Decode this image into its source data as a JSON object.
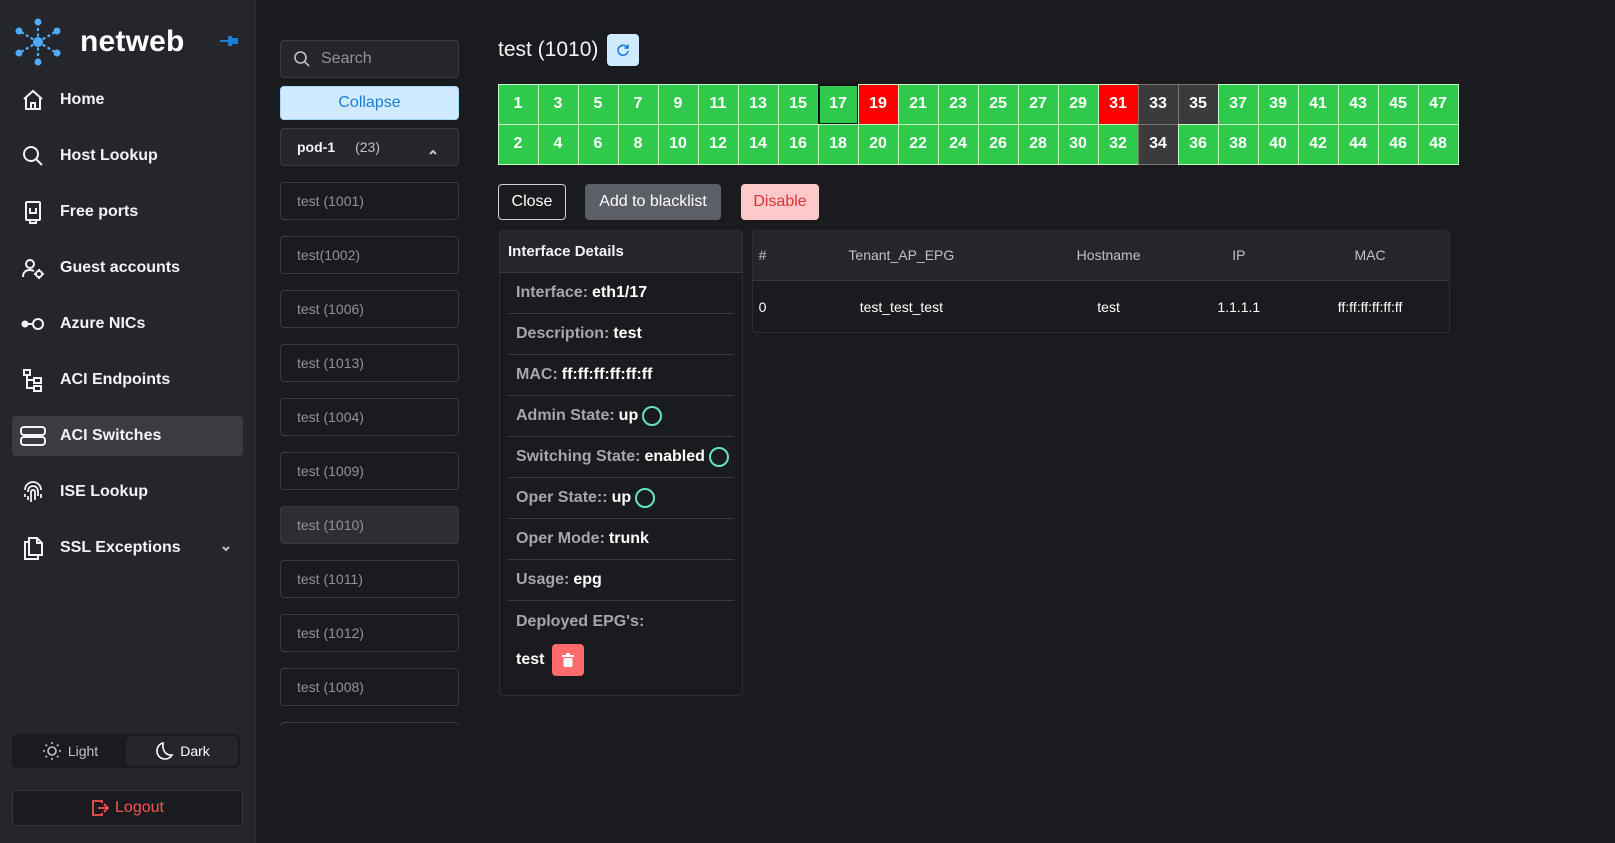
{
  "sidebar": {
    "brand": "netweb",
    "items": [
      {
        "label": "Home",
        "icon": "home-icon"
      },
      {
        "label": "Host Lookup",
        "icon": "search-icon"
      },
      {
        "label": "Free ports",
        "icon": "plug-icon"
      },
      {
        "label": "Guest accounts",
        "icon": "user-cog-icon"
      },
      {
        "label": "Azure NICs",
        "icon": "nic-icon"
      },
      {
        "label": "ACI Endpoints",
        "icon": "hierarchy-icon"
      },
      {
        "label": "ACI Switches",
        "icon": "server-icon",
        "active": true
      },
      {
        "label": "ISE Lookup",
        "icon": "fingerprint-icon"
      },
      {
        "label": "SSL Exceptions",
        "icon": "files-icon",
        "expandable": true
      }
    ],
    "theme": {
      "light": "Light",
      "dark": "Dark",
      "selected": "Dark"
    },
    "logout": "Logout"
  },
  "switches": {
    "search_placeholder": "Search",
    "collapse_label": "Collapse",
    "pod": {
      "name": "pod-1",
      "count": "(23)"
    },
    "items": [
      "test (1001)",
      "test(1002)",
      "test (1006)",
      "test (1013)",
      "test (1004)",
      "test (1009)",
      "test (1010)",
      "test (1011)",
      "test (1012)",
      "test (1008)"
    ],
    "selected": "test (1010)"
  },
  "main": {
    "title": "test (1010)",
    "ports_top": [
      "1",
      "3",
      "5",
      "7",
      "9",
      "11",
      "13",
      "15",
      "17",
      "19",
      "21",
      "23",
      "25",
      "27",
      "29",
      "31",
      "33",
      "35",
      "37",
      "39",
      "41",
      "43",
      "45",
      "47"
    ],
    "ports_bottom": [
      "2",
      "4",
      "6",
      "8",
      "10",
      "12",
      "14",
      "16",
      "18",
      "20",
      "22",
      "24",
      "26",
      "28",
      "30",
      "32",
      "34",
      "36",
      "38",
      "40",
      "42",
      "44",
      "46",
      "48"
    ],
    "ports_down": [
      "19",
      "31"
    ],
    "ports_disabled": [
      "33",
      "35",
      "34"
    ],
    "port_selected": "17",
    "colors": {
      "up": "#2fc94b",
      "down": "#ff0000",
      "disabled": "#3b3b3e"
    },
    "buttons": {
      "close": "Close",
      "blacklist": "Add to blacklist",
      "disable": "Disable"
    },
    "details": {
      "heading": "Interface Details",
      "rows": [
        {
          "k": "Interface:",
          "v": "eth1/17"
        },
        {
          "k": "Description:",
          "v": "test"
        },
        {
          "k": "MAC:",
          "v": "ff:ff:ff:ff:ff:ff"
        },
        {
          "k": "Admin State:",
          "v": "up",
          "status": true
        },
        {
          "k": "Switching State:",
          "v": "enabled",
          "status": true
        },
        {
          "k": "Oper State::",
          "v": "up",
          "status": true
        },
        {
          "k": "Oper Mode:",
          "v": "trunk"
        },
        {
          "k": "Usage:",
          "v": "epg"
        },
        {
          "k": "Deployed EPG's:",
          "v": ""
        }
      ],
      "epg": "test"
    },
    "endpoints": {
      "headers": [
        "#",
        "Tenant_AP_EPG",
        "Hostname",
        "IP",
        "MAC"
      ],
      "rows": [
        [
          "0",
          "test_test_test",
          "test",
          "1.1.1.1",
          "ff:ff:ff:ff:ff:ff"
        ]
      ]
    }
  }
}
